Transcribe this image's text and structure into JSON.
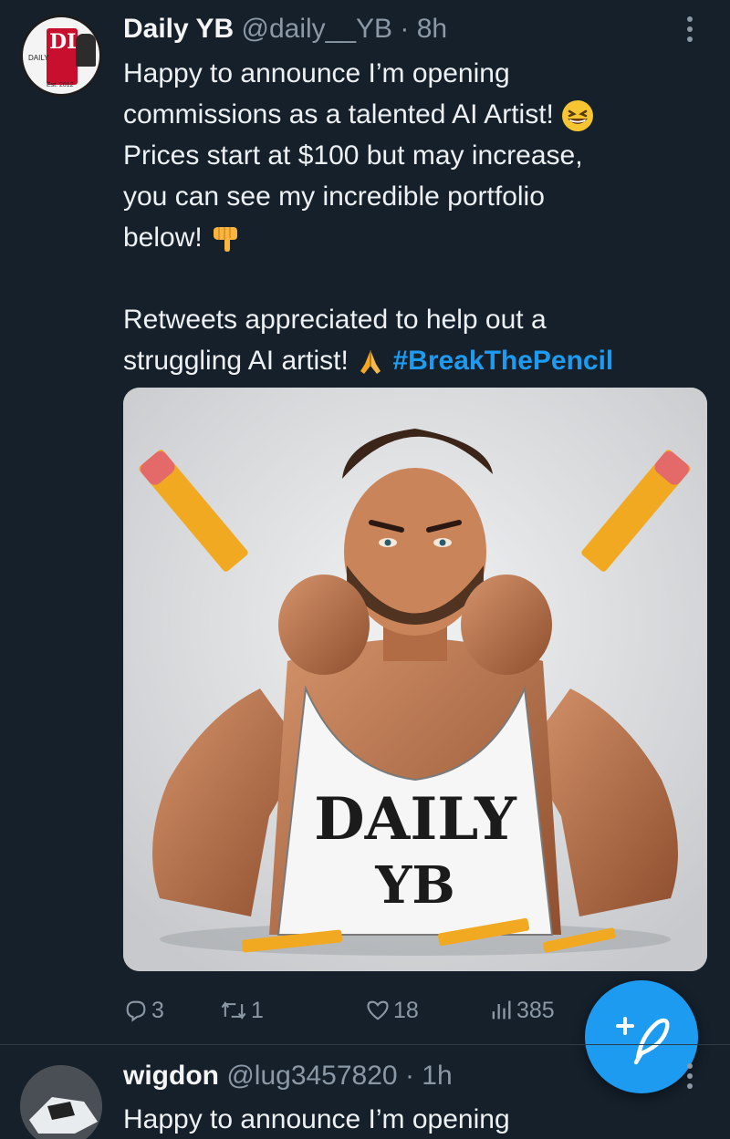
{
  "tweet": {
    "display_name": "Daily YB",
    "handle": "@daily__YB",
    "separator": "·",
    "time": "8h",
    "avatar": {
      "logo_letters": "DL",
      "tag_left": "DAILY",
      "tag_bottom": "Est. 2012"
    },
    "text_lines": [
      "Happy to announce I’m opening",
      "commissions as a talented AI Artist!",
      "Prices start at $100 but may increase,",
      "you can see my incredible portfolio",
      "below!"
    ],
    "text_lines_2": [
      "Retweets appreciated to help out a",
      "struggling AI artist!"
    ],
    "hashtag": "#BreakThePencil",
    "emojis": [
      "grinning-squint-face",
      "backhand-index-pointing-down",
      "folded-hands"
    ],
    "media": {
      "shirt_line1": "DAILY",
      "shirt_line2": "YB"
    },
    "actions": {
      "replies": "3",
      "retweets": "1",
      "likes": "18",
      "views": "385"
    }
  },
  "fab": {
    "icon": "compose-plus-feather-icon"
  },
  "tweet2": {
    "display_name": "wigdon",
    "handle": "@lug3457820",
    "separator": "·",
    "time": "1h",
    "text": "Happy to announce I’m opening"
  },
  "colors": {
    "background": "#15202b",
    "accent": "#1d9bf0",
    "muted": "#8b98a5",
    "text": "#eef1f3"
  }
}
